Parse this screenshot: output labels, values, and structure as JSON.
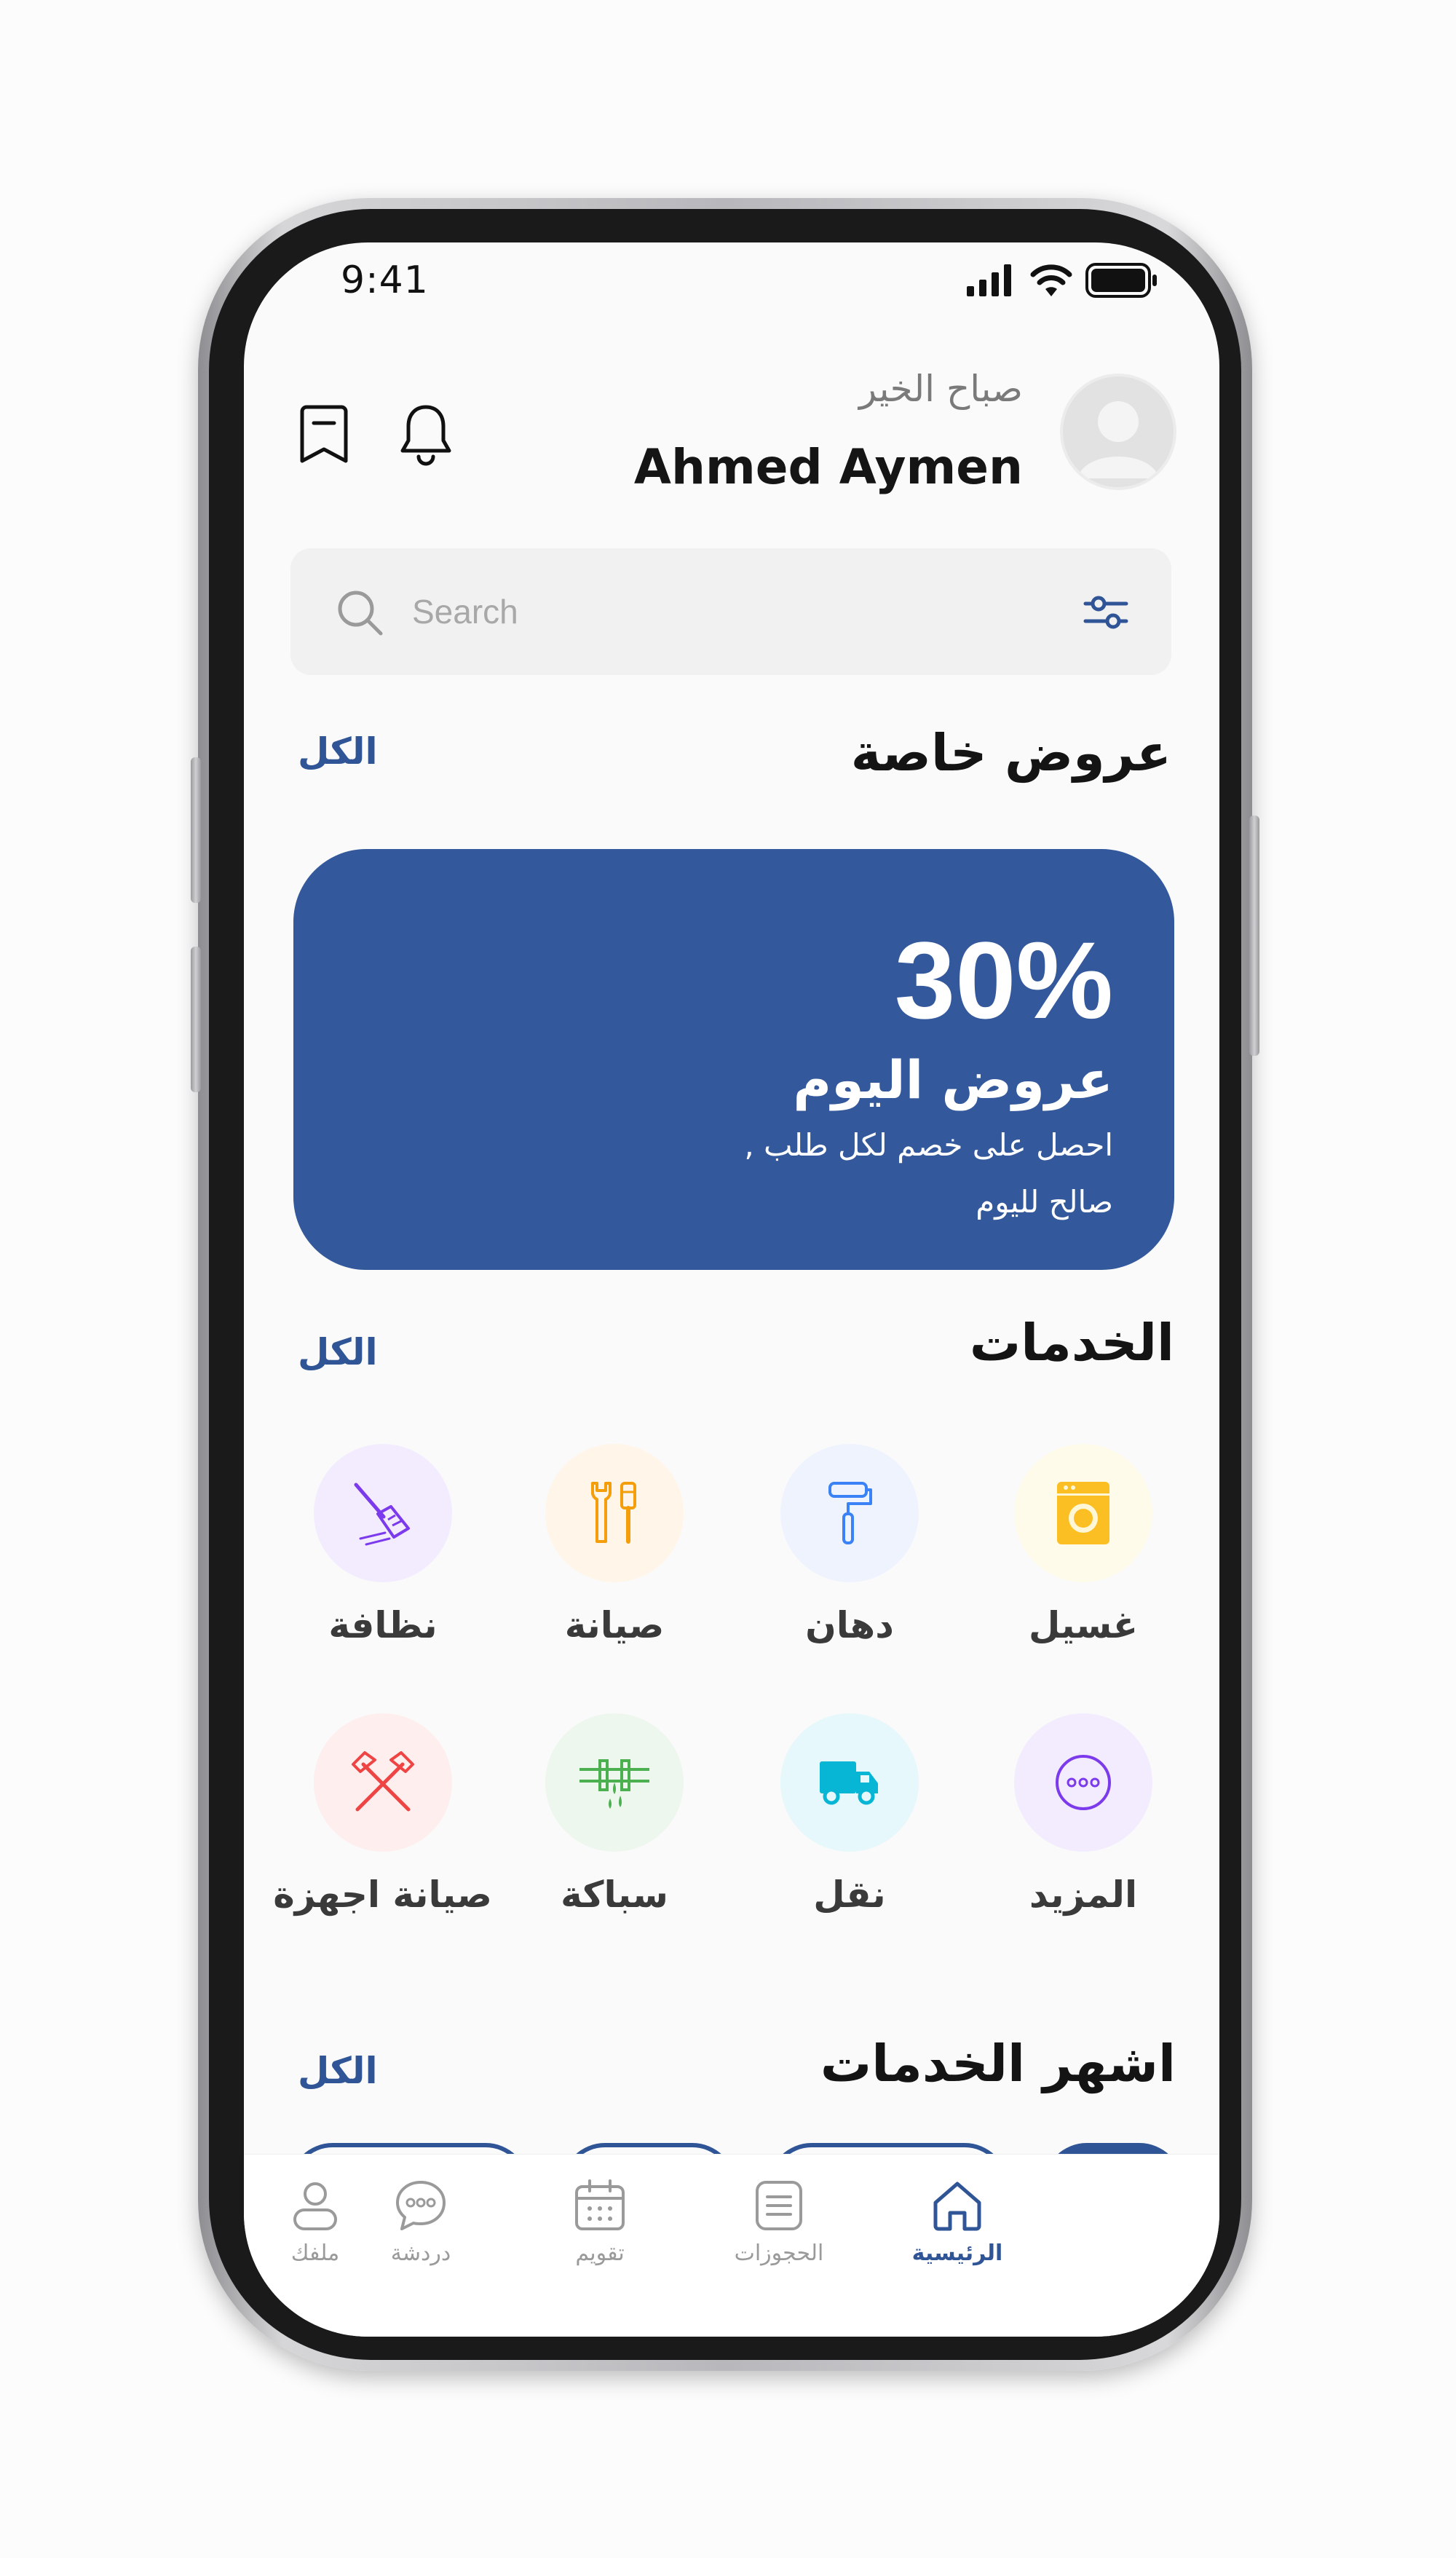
{
  "status_bar": {
    "time": "9:41"
  },
  "header": {
    "greeting": "صباح الخير",
    "user_name": "Ahmed Aymen"
  },
  "search": {
    "placeholder": "Search"
  },
  "special_offers": {
    "title": "عروض خاصة",
    "see_all": "الكل",
    "card": {
      "discount": "30%",
      "title": "عروض اليوم",
      "line1": "احصل على خصم لكل طلب ,",
      "line2": "صالح لليوم"
    }
  },
  "services": {
    "title": "الخدمات",
    "see_all": "الكل",
    "items": [
      {
        "label": "غسيل",
        "icon": "washing-machine-icon",
        "color": "#fbbf24",
        "bg": "#fffbeb"
      },
      {
        "label": "دهان",
        "icon": "paint-roller-icon",
        "color": "#3b82f6",
        "bg": "#eef3fe"
      },
      {
        "label": "صيانة",
        "icon": "wrench-screwdriver-icon",
        "color": "#f59e0b",
        "bg": "#fff5e8"
      },
      {
        "label": "نظافة",
        "icon": "broom-icon",
        "color": "#7c3aed",
        "bg": "#f3ecfe"
      },
      {
        "label": "المزيد",
        "icon": "more-icon",
        "color": "#7c3aed",
        "bg": "#f3ecfe"
      },
      {
        "label": "نقل",
        "icon": "truck-icon",
        "color": "#06b6d4",
        "bg": "#e6f8fb"
      },
      {
        "label": "سباكة",
        "icon": "pipe-icon",
        "color": "#4caf50",
        "bg": "#edf7ee"
      },
      {
        "label": "صيانة اجهزة",
        "icon": "hammers-icon",
        "color": "#ef4444",
        "bg": "#feeeee"
      }
    ]
  },
  "popular": {
    "title": "اشهر الخدمات",
    "see_all": "الكل"
  },
  "nav": [
    {
      "label": "الرئيسية",
      "icon": "home-icon",
      "active": true
    },
    {
      "label": "الحجوزات",
      "icon": "bookings-icon",
      "active": false
    },
    {
      "label": "تقويم",
      "icon": "calendar-icon",
      "active": false
    },
    {
      "label": "دردشة",
      "icon": "chat-icon",
      "active": false
    },
    {
      "label": "ملفك",
      "icon": "profile-icon",
      "active": false
    }
  ],
  "colors": {
    "accent": "#2f5597",
    "offer_bg": "#33589b",
    "phone_body": "#1a1a1a"
  }
}
